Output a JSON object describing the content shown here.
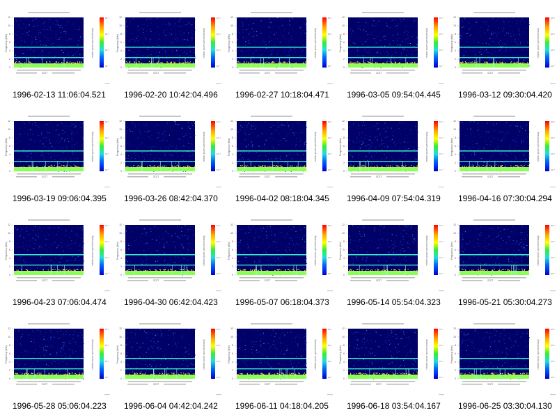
{
  "plot_title_prefix": "Voyager-1 PWS Wideband",
  "y_axis_label": "Frequency (kHz)",
  "y_ticks": [
    "12",
    "10",
    "8",
    "6",
    "4",
    "2",
    "0"
  ],
  "colorbar_label": "relative power spectral density",
  "colorbar_ticks": [
    "10⁻¹",
    "10⁻²",
    "10⁻³",
    "10⁻⁴"
  ],
  "scet_label": "SCET",
  "colors": {
    "background": "#000066",
    "band": "#33e6cc",
    "low_band": "#88ff55"
  },
  "items": [
    {
      "caption": "1996-02-13 11:06:04.521"
    },
    {
      "caption": "1996-02-20 10:42:04.496"
    },
    {
      "caption": "1996-02-27 10:18:04.471"
    },
    {
      "caption": "1996-03-05 09:54:04.445"
    },
    {
      "caption": "1996-03-12 09:30:04.420"
    },
    {
      "caption": "1996-03-19 09:06:04.395"
    },
    {
      "caption": "1996-03-26 08:42:04.370"
    },
    {
      "caption": "1996-04-02 08:18:04.345"
    },
    {
      "caption": "1996-04-09 07:54:04.319"
    },
    {
      "caption": "1996-04-16 07:30:04.294"
    },
    {
      "caption": "1996-04-23 07:06:04.474"
    },
    {
      "caption": "1996-04-30 06:42:04.423"
    },
    {
      "caption": "1996-05-07 06:18:04.373"
    },
    {
      "caption": "1996-05-14 05:54:04.323"
    },
    {
      "caption": "1996-05-21 05:30:04.273"
    },
    {
      "caption": "1996-05-28 05:06:04.223"
    },
    {
      "caption": "1996-06-04 04:42:04.242"
    },
    {
      "caption": "1996-06-11 04:18:04.205"
    },
    {
      "caption": "1996-06-18 03:54:04.167"
    },
    {
      "caption": "1996-06-25 03:30:04.130"
    }
  ]
}
